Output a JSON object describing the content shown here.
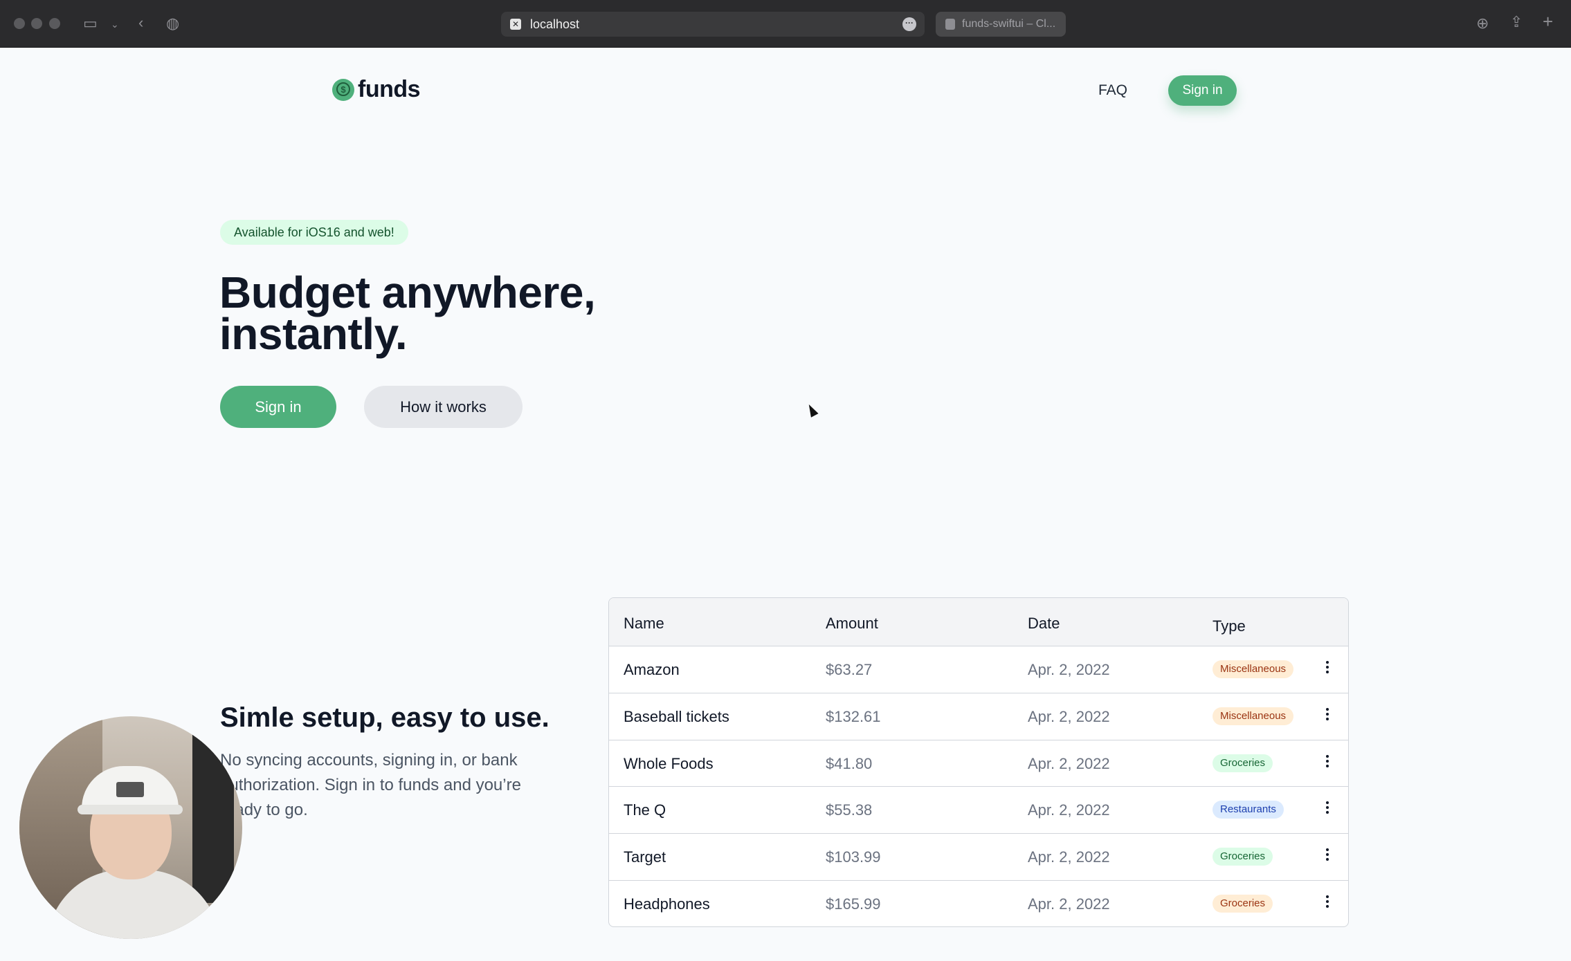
{
  "browser": {
    "url": "localhost",
    "second_tab": "funds-swiftui – Cl..."
  },
  "nav": {
    "logo_text": "funds",
    "faq_label": "FAQ",
    "signin_label": "Sign in"
  },
  "hero": {
    "badge": "Available for iOS16 and web!",
    "title_line1": "Budget anywhere,",
    "title_line2": "instantly.",
    "primary_button": "Sign in",
    "secondary_button": "How it works"
  },
  "features": {
    "title": "Simle setup, easy to use.",
    "body": "No syncing accounts, signing in, or bank authorization. Sign in to funds and you’re ready to go."
  },
  "table": {
    "headers": {
      "name": "Name",
      "amount": "Amount",
      "date": "Date",
      "type": "Type"
    },
    "rows": [
      {
        "name": "Amazon",
        "amount": "$63.27",
        "date": "Apr. 2, 2022",
        "type": "Miscellaneous"
      },
      {
        "name": "Baseball tickets",
        "amount": "$132.61",
        "date": "Apr. 2, 2022",
        "type": "Miscellaneous"
      },
      {
        "name": "Whole Foods",
        "amount": "$41.80",
        "date": "Apr. 2, 2022",
        "type": "Groceries"
      },
      {
        "name": "The Q",
        "amount": "$55.38",
        "date": "Apr. 2, 2022",
        "type": "Restaurants"
      },
      {
        "name": "Target",
        "amount": "$103.99",
        "date": "Apr. 2, 2022",
        "type": "Groceries"
      },
      {
        "name": "Headphones",
        "amount": "$165.99",
        "date": "Apr. 2, 2022",
        "type": "Groceries"
      }
    ]
  },
  "tag_colors": {
    "misc": {
      "bg": "#ffedd5",
      "fg": "#9a3412"
    },
    "groceries": {
      "bg": "#dcfce7",
      "fg": "#166534"
    },
    "restaurants": {
      "bg": "#dbeafe",
      "fg": "#1e40af"
    },
    "groceries_alt": {
      "bg": "#ffedd5",
      "fg": "#9a3412"
    }
  },
  "colors": {
    "accent": "#4fb07c",
    "page_bg": "#f8fafc"
  }
}
